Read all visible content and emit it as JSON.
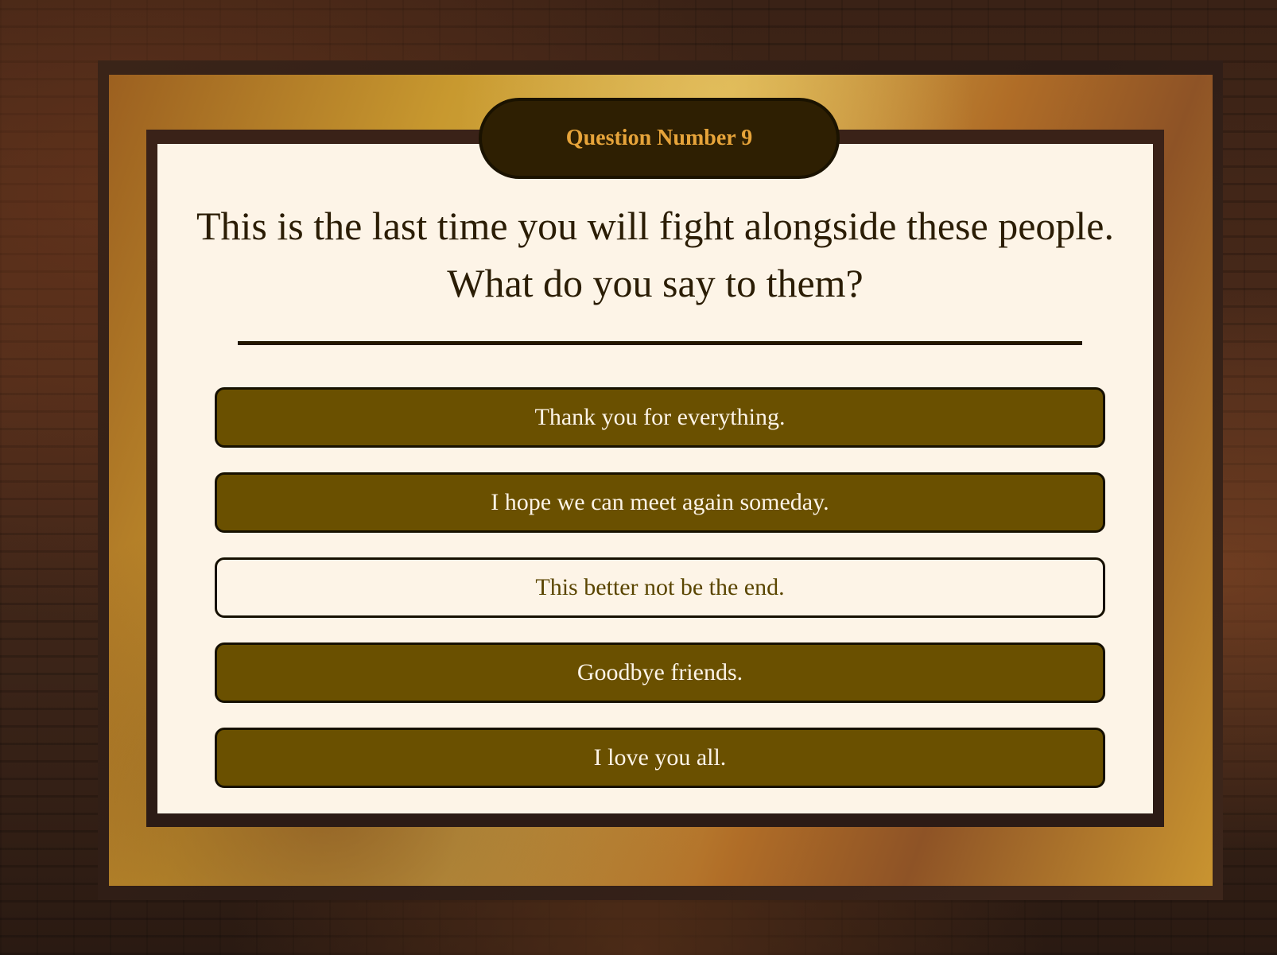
{
  "quiz": {
    "question_badge": "Question Number 9",
    "question_line1": "This is the last time you will fight alongside these people.",
    "question_line2": "What do you say to them?",
    "answers": [
      {
        "label": "Thank you for everything.",
        "selected": false
      },
      {
        "label": "I hope we can meet again someday.",
        "selected": false
      },
      {
        "label": "This better not be the end.",
        "selected": true
      },
      {
        "label": "Goodbye friends.",
        "selected": false
      },
      {
        "label": "I love you all.",
        "selected": false
      }
    ]
  },
  "colors": {
    "panel": "#fdf4e7",
    "answer_fill": "#6a5000",
    "badge_fill": "#2e1f02",
    "badge_text": "#e7a43a",
    "frame_gold": "#c8992f"
  }
}
